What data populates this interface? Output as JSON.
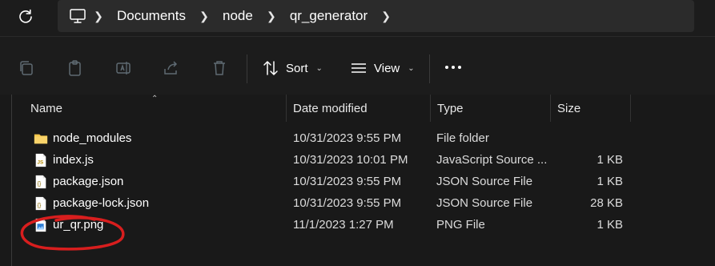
{
  "address": {
    "crumbs": [
      "Documents",
      "node",
      "qr_generator"
    ]
  },
  "toolbar": {
    "sort_label": "Sort",
    "view_label": "View"
  },
  "columns": {
    "name": "Name",
    "date": "Date modified",
    "type": "Type",
    "size": "Size"
  },
  "files": [
    {
      "name": "node_modules",
      "date": "10/31/2023 9:55 PM",
      "type": "File folder",
      "size": "",
      "icon": "folder-icon"
    },
    {
      "name": "index.js",
      "date": "10/31/2023 10:01 PM",
      "type": "JavaScript Source ...",
      "size": "1 KB",
      "icon": "js-file-icon"
    },
    {
      "name": "package.json",
      "date": "10/31/2023 9:55 PM",
      "type": "JSON Source File",
      "size": "1 KB",
      "icon": "json-file-icon"
    },
    {
      "name": "package-lock.json",
      "date": "10/31/2023 9:55 PM",
      "type": "JSON Source File",
      "size": "28 KB",
      "icon": "json-file-icon"
    },
    {
      "name": "ur_qr.png",
      "date": "11/1/2023 1:27 PM",
      "type": "PNG File",
      "size": "1 KB",
      "icon": "png-file-icon"
    }
  ],
  "colors": {
    "folder": "#f4c64b",
    "annotation": "#d81e1e",
    "disabled_icon": "#5e6a72"
  }
}
